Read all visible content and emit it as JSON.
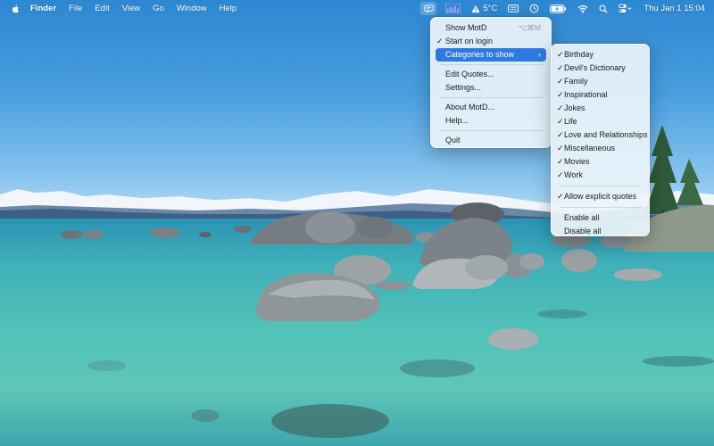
{
  "menubar": {
    "apple_icon": "apple-logo-icon",
    "items": [
      "Finder",
      "File",
      "Edit",
      "View",
      "Go",
      "Window",
      "Help"
    ],
    "status": {
      "motd_icon": "motd-chat-icon",
      "weather_icon": "warning-triangle-icon",
      "temperature": "5°C",
      "icons": [
        "keyboard-icon",
        "clock-history-icon",
        "battery-charging-icon",
        "wifi-icon",
        "search-icon",
        "control-center-icon"
      ],
      "datetime": "Thu Jan 1  15:04"
    }
  },
  "main_menu": {
    "items": [
      {
        "label": "Show MotD",
        "shortcut": "⌥⌘M",
        "checked": false
      },
      {
        "label": "Start on login",
        "checked": true
      },
      {
        "label": "Categories to show",
        "submenu": true,
        "selected": true
      },
      {
        "label": "Edit Quotes..."
      },
      {
        "label": "Settings..."
      },
      {
        "label": "About MotD..."
      },
      {
        "label": "Help..."
      },
      {
        "label": "Quit"
      }
    ]
  },
  "sub_menu": {
    "categories": [
      "Birthday",
      "Devil's Dictionary",
      "Family",
      "Inspirational",
      "Jokes",
      "Life",
      "Love and Relationships",
      "Miscellaneous",
      "Movies",
      "Work"
    ],
    "explicit": "Allow explicit quotes",
    "enable_all": "Enable all",
    "disable_all": "Disable all"
  },
  "glyphs": {
    "check": "✓",
    "chevron": "›"
  },
  "colors": {
    "selection": "#2f7ae0",
    "menu_bg": "#ecf4fa"
  }
}
